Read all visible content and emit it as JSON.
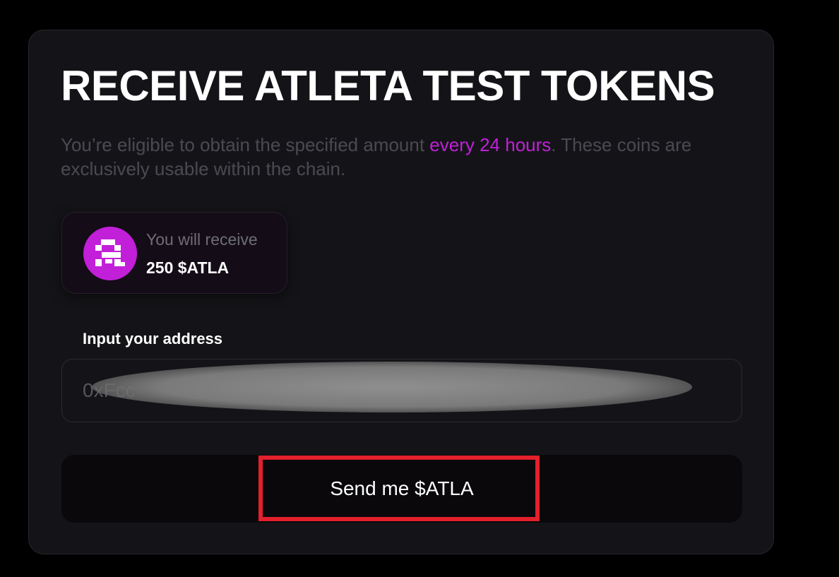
{
  "header": {
    "title": "RECEIVE ATLETA TEST TOKENS"
  },
  "description": {
    "part1": "You’re eligible to obtain the specified amount ",
    "highlight": "every 24 hours",
    "part2": ". These coins are exclusively usable within the chain."
  },
  "receive": {
    "label": "You will receive",
    "amount": "250 $ATLA",
    "icon": "atleta-logo-icon"
  },
  "address": {
    "label": "Input your address",
    "value": "0xFcc"
  },
  "actions": {
    "send_label": "Send me $ATLA"
  },
  "colors": {
    "accent": "#c21fd9",
    "background": "#000000",
    "card": "#141418",
    "highlight_box": "#e3202b"
  }
}
